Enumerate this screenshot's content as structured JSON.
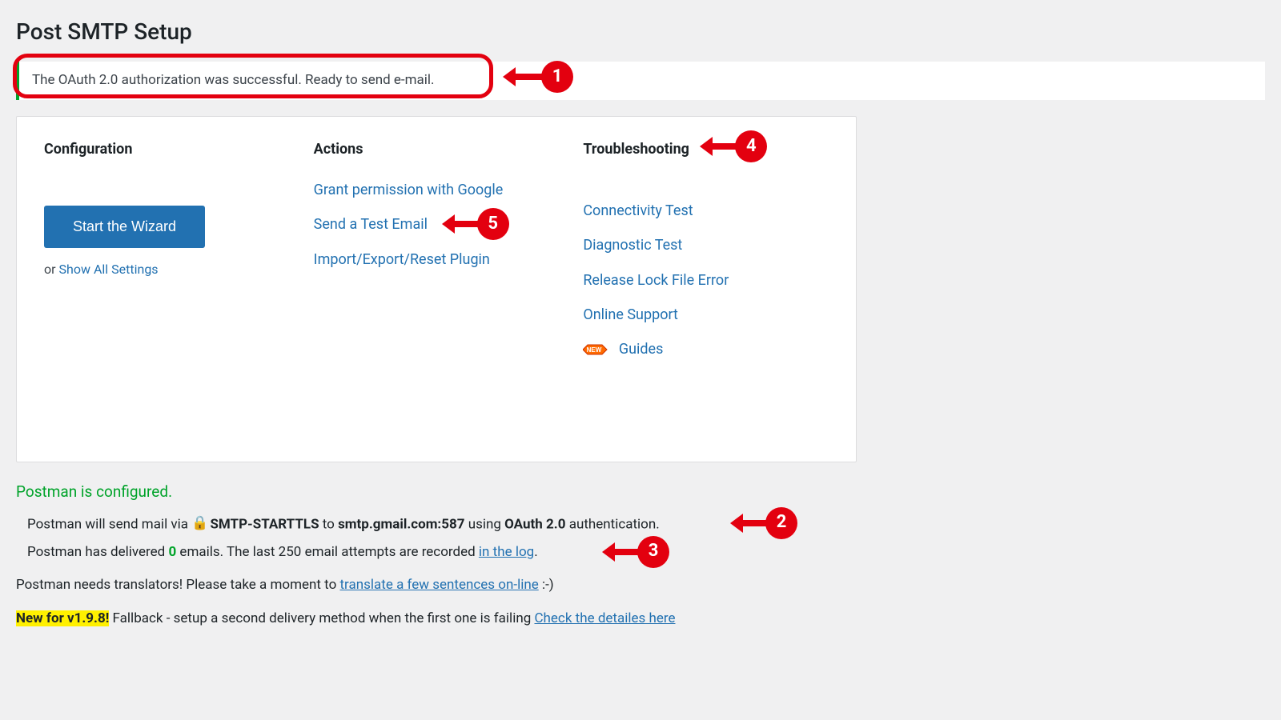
{
  "page_title": "Post SMTP Setup",
  "notice": {
    "message": "The OAuth 2.0 authorization was successful. Ready to send e-mail."
  },
  "callouts": {
    "c1": "1",
    "c2": "2",
    "c3": "3",
    "c4": "4",
    "c5": "5"
  },
  "columns": {
    "config": {
      "heading": "Configuration",
      "button": "Start the Wizard",
      "or": "or ",
      "show_all": "Show All Settings"
    },
    "actions": {
      "heading": "Actions",
      "items": [
        "Grant permission with Google",
        "Send a Test Email",
        "Import/Export/Reset Plugin"
      ]
    },
    "troubleshooting": {
      "heading": "Troubleshooting",
      "items": [
        "Connectivity Test",
        "Diagnostic Test",
        "Release Lock File Error",
        "Online Support",
        "Guides"
      ],
      "new_badge": "NEW"
    }
  },
  "status": {
    "title": "Postman is configured.",
    "line1_pre": "Postman will send mail via ",
    "line1_b1": "SMTP-STARTTLS",
    "line1_mid1": " to ",
    "line1_b2": "smtp.gmail.com:587",
    "line1_mid2": " using ",
    "line1_b3": "OAuth 2.0",
    "line1_post": " authentication.",
    "line2_pre": "Postman has delivered ",
    "line2_zero": "0",
    "line2_mid": " emails. The last 250 email attempts are recorded ",
    "line2_link": "in the log",
    "line2_post": "."
  },
  "translators": {
    "pre": "Postman needs translators! Please take a moment to ",
    "link": "translate a few sentences on-line",
    "post": " :-)"
  },
  "newfor": {
    "highlight": "New for v1.9.8!",
    "mid": " Fallback - setup a second delivery method when the first one is failing ",
    "link": "Check the detailes here"
  }
}
